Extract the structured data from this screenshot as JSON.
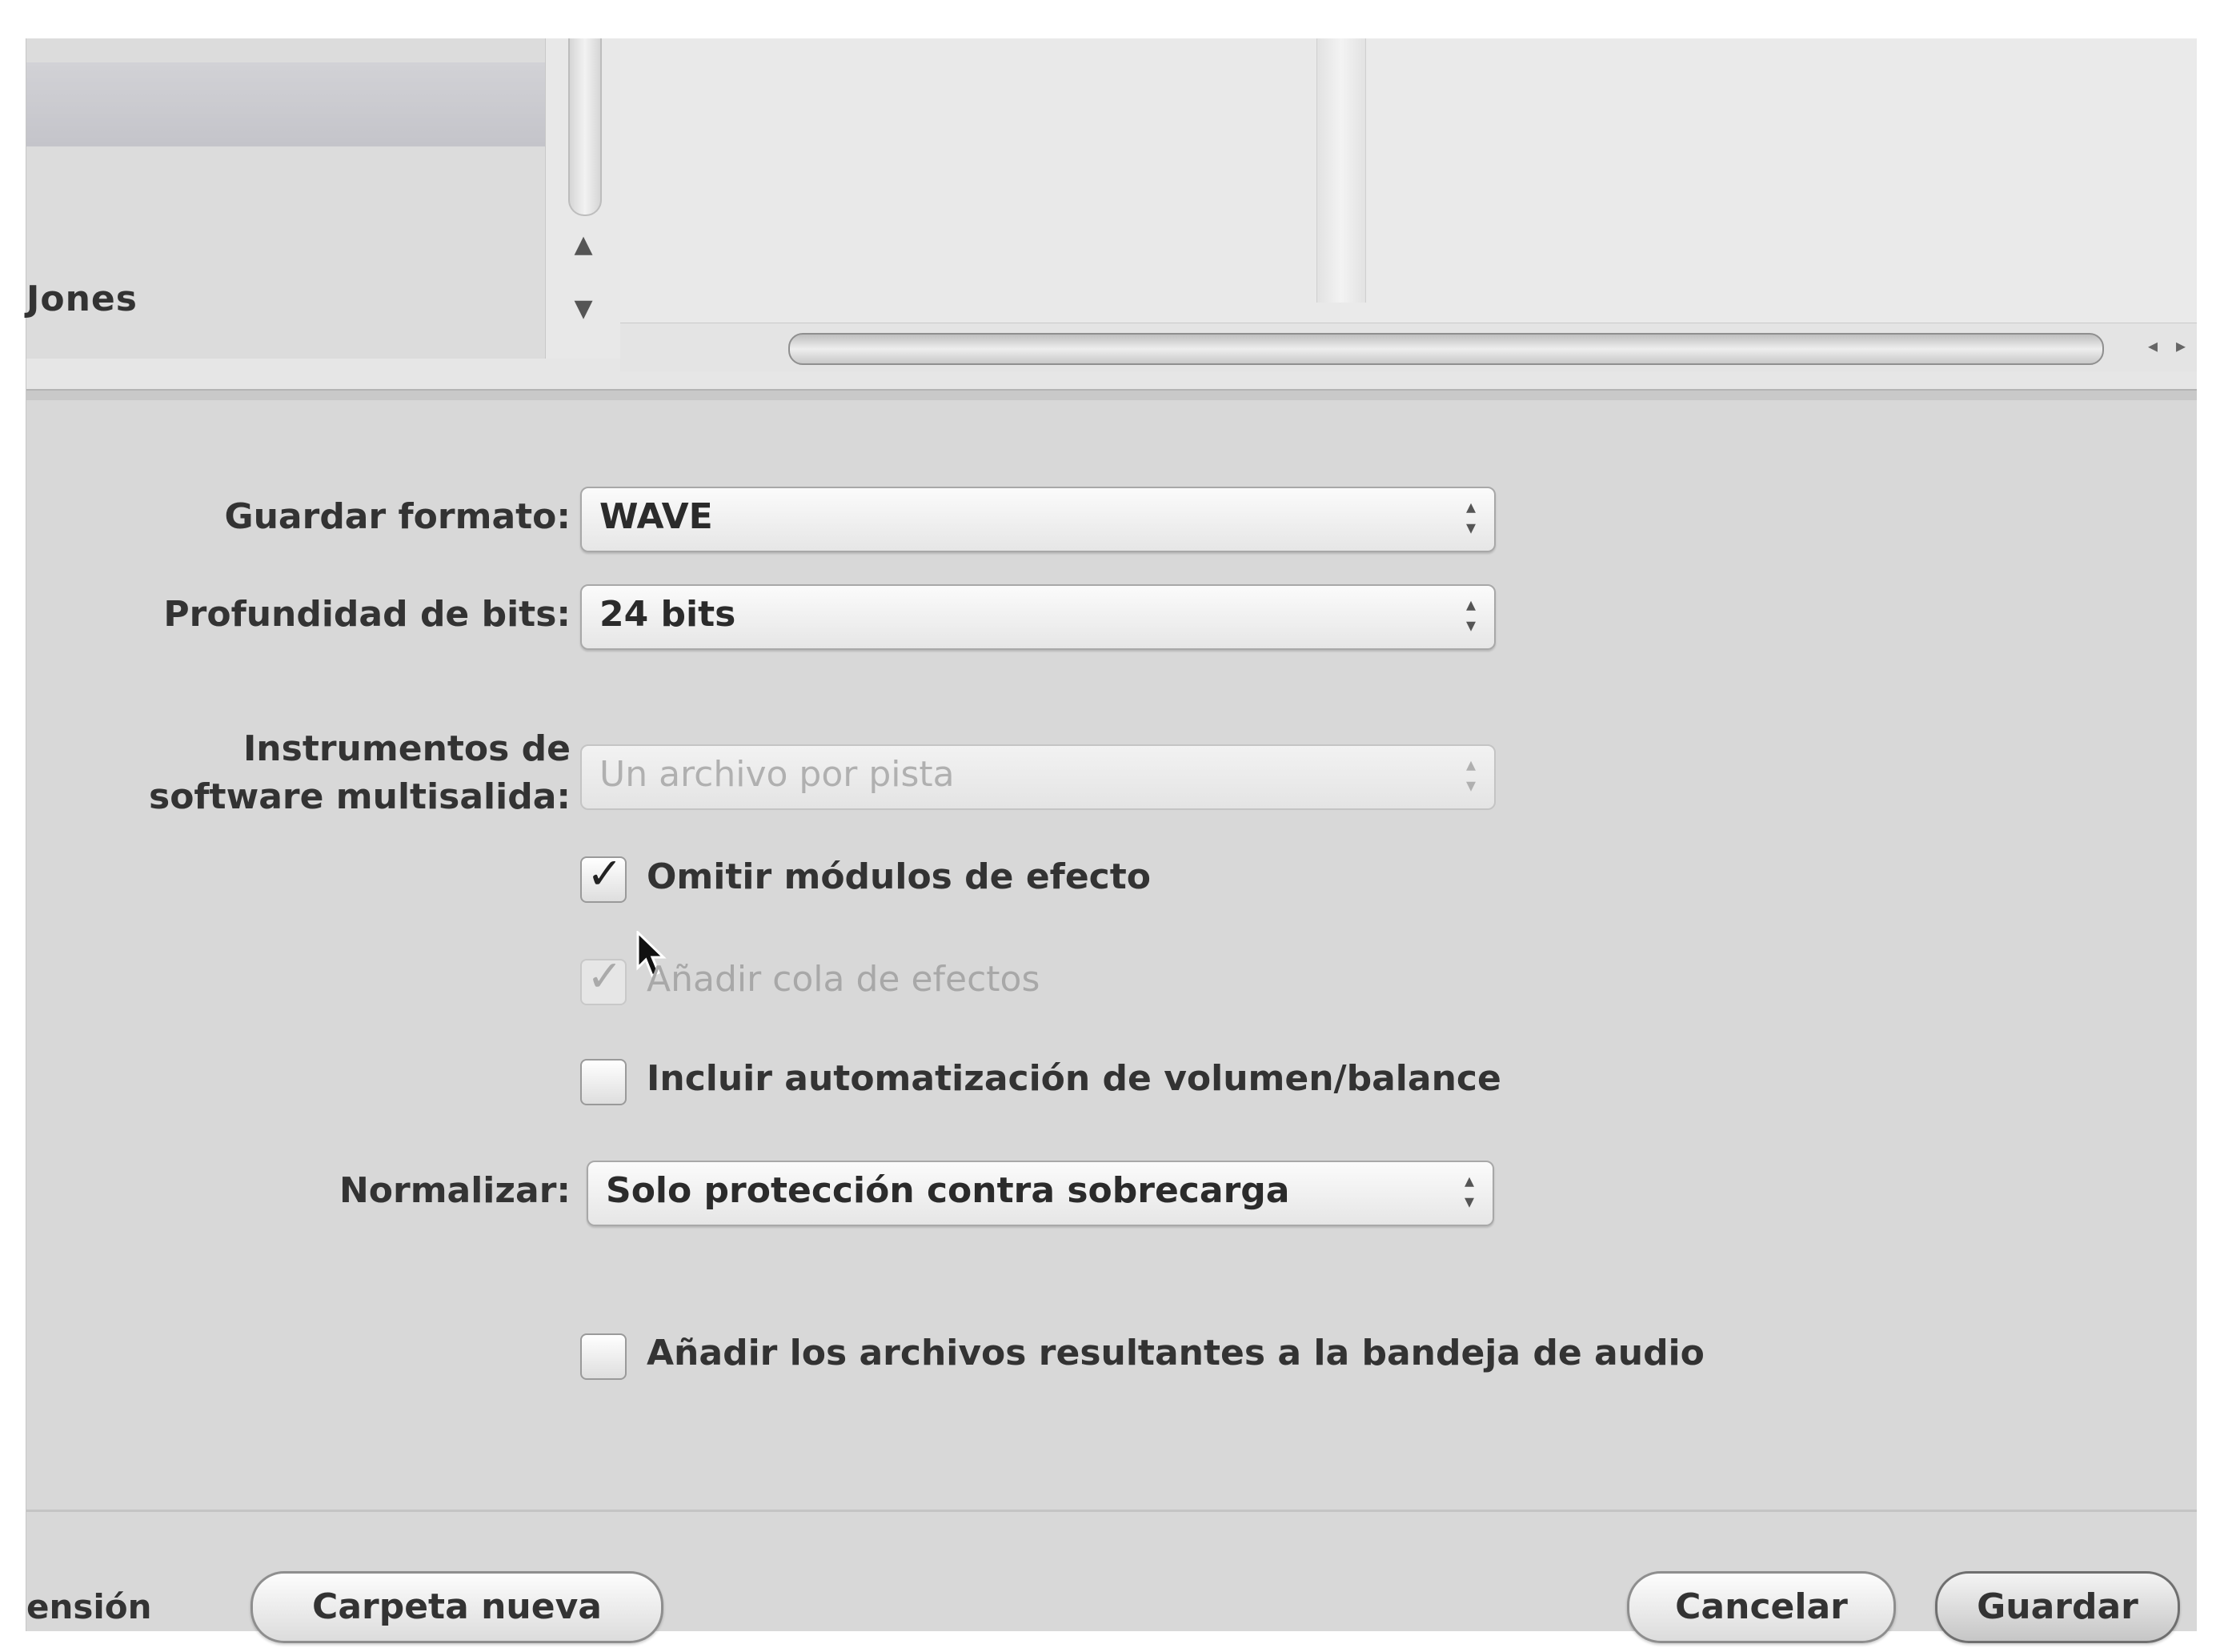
{
  "browser": {
    "sidebar_item": "Jones"
  },
  "form": {
    "save_format_label": "Guardar formato:",
    "save_format_value": "WAVE",
    "bit_depth_label": "Profundidad de bits:",
    "bit_depth_value": "24 bits",
    "multi_output_label_line1": "Instrumentos de",
    "multi_output_label_line2": "software multisalida:",
    "multi_output_value": "Un archivo por pista",
    "bypass_effects_label": "Omitir módulos de efecto",
    "bypass_effects_checked": true,
    "add_effect_tail_label": "Añadir cola de efectos",
    "add_effect_tail_checked": true,
    "include_automation_label": "Incluir automatización de volumen/balance",
    "include_automation_checked": false,
    "normalize_label": "Normalizar:",
    "normalize_value": "Solo protección contra sobrecarga",
    "add_to_audio_bin_label": "Añadir los archivos resultantes a la bandeja de audio",
    "add_to_audio_bin_checked": false
  },
  "bottom": {
    "left_text": "ensión",
    "new_folder_label": "Carpeta nueva",
    "cancel_label": "Cancelar",
    "save_label": "Guardar"
  },
  "icons": {
    "checkmark": "checkmark-icon",
    "stepper": "up-down-stepper-icon",
    "cursor": "arrow-cursor-icon"
  }
}
